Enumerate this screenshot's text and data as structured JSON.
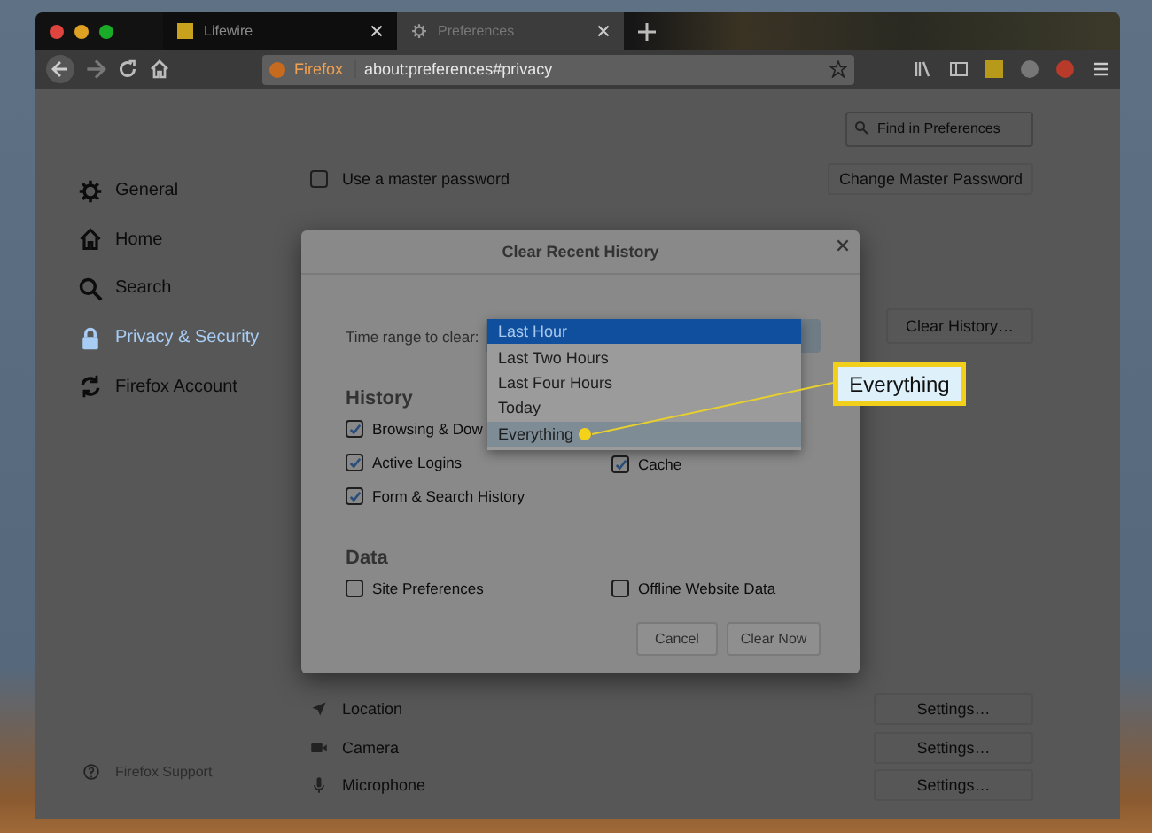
{
  "browser": {
    "tabs": [
      {
        "label": "Lifewire",
        "kind": "site",
        "selected": false
      },
      {
        "label": "Preferences",
        "kind": "settings",
        "selected": true
      }
    ],
    "url": {
      "identity": "Firefox",
      "address": "about:preferences#privacy"
    }
  },
  "sidebar": {
    "items": [
      {
        "label": "General",
        "kind": "gear",
        "selected": false
      },
      {
        "label": "Home",
        "kind": "home",
        "selected": false
      },
      {
        "label": "Search",
        "kind": "search",
        "selected": false
      },
      {
        "label": "Privacy & Security",
        "kind": "lock",
        "selected": true
      },
      {
        "label": "Firefox Account",
        "kind": "sync",
        "selected": false
      }
    ],
    "support": "Firefox Support"
  },
  "search": {
    "placeholder": "Find in Preferences"
  },
  "master_password": {
    "label": "Use a master password",
    "checked": false,
    "button": "Change Master Password"
  },
  "clear_history_button": "Clear History…",
  "permissions": [
    {
      "label": "Location",
      "kind": "location",
      "button": "Settings…"
    },
    {
      "label": "Camera",
      "kind": "camera",
      "button": "Settings…"
    },
    {
      "label": "Microphone",
      "kind": "microphone",
      "button": "Settings…"
    }
  ],
  "dialog": {
    "title": "Clear Recent History",
    "time_range_label": "Time range to clear:",
    "time_range_options": [
      {
        "label": "Last Hour",
        "selected": true,
        "hovered": false
      },
      {
        "label": "Last Two Hours",
        "selected": false,
        "hovered": false
      },
      {
        "label": "Last Four Hours",
        "selected": false,
        "hovered": false
      },
      {
        "label": "Today",
        "selected": false,
        "hovered": false
      },
      {
        "label": "Everything",
        "selected": false,
        "hovered": true
      }
    ],
    "history_heading": "History",
    "history_columns": [
      {
        "items": [
          {
            "label": "Browsing & Dow",
            "checked": true
          },
          {
            "label": "Active Logins",
            "checked": true
          },
          {
            "label": "Form & Search History",
            "checked": true
          }
        ]
      },
      {
        "items": [
          {
            "label": "Cache",
            "checked": true
          }
        ]
      }
    ],
    "data_heading": "Data",
    "data_items": [
      {
        "label": "Site Preferences",
        "checked": false
      },
      {
        "label": "Offline Website Data",
        "checked": false
      }
    ],
    "buttons": [
      "Cancel",
      "Clear Now"
    ]
  },
  "callout": {
    "label": "Everything"
  }
}
